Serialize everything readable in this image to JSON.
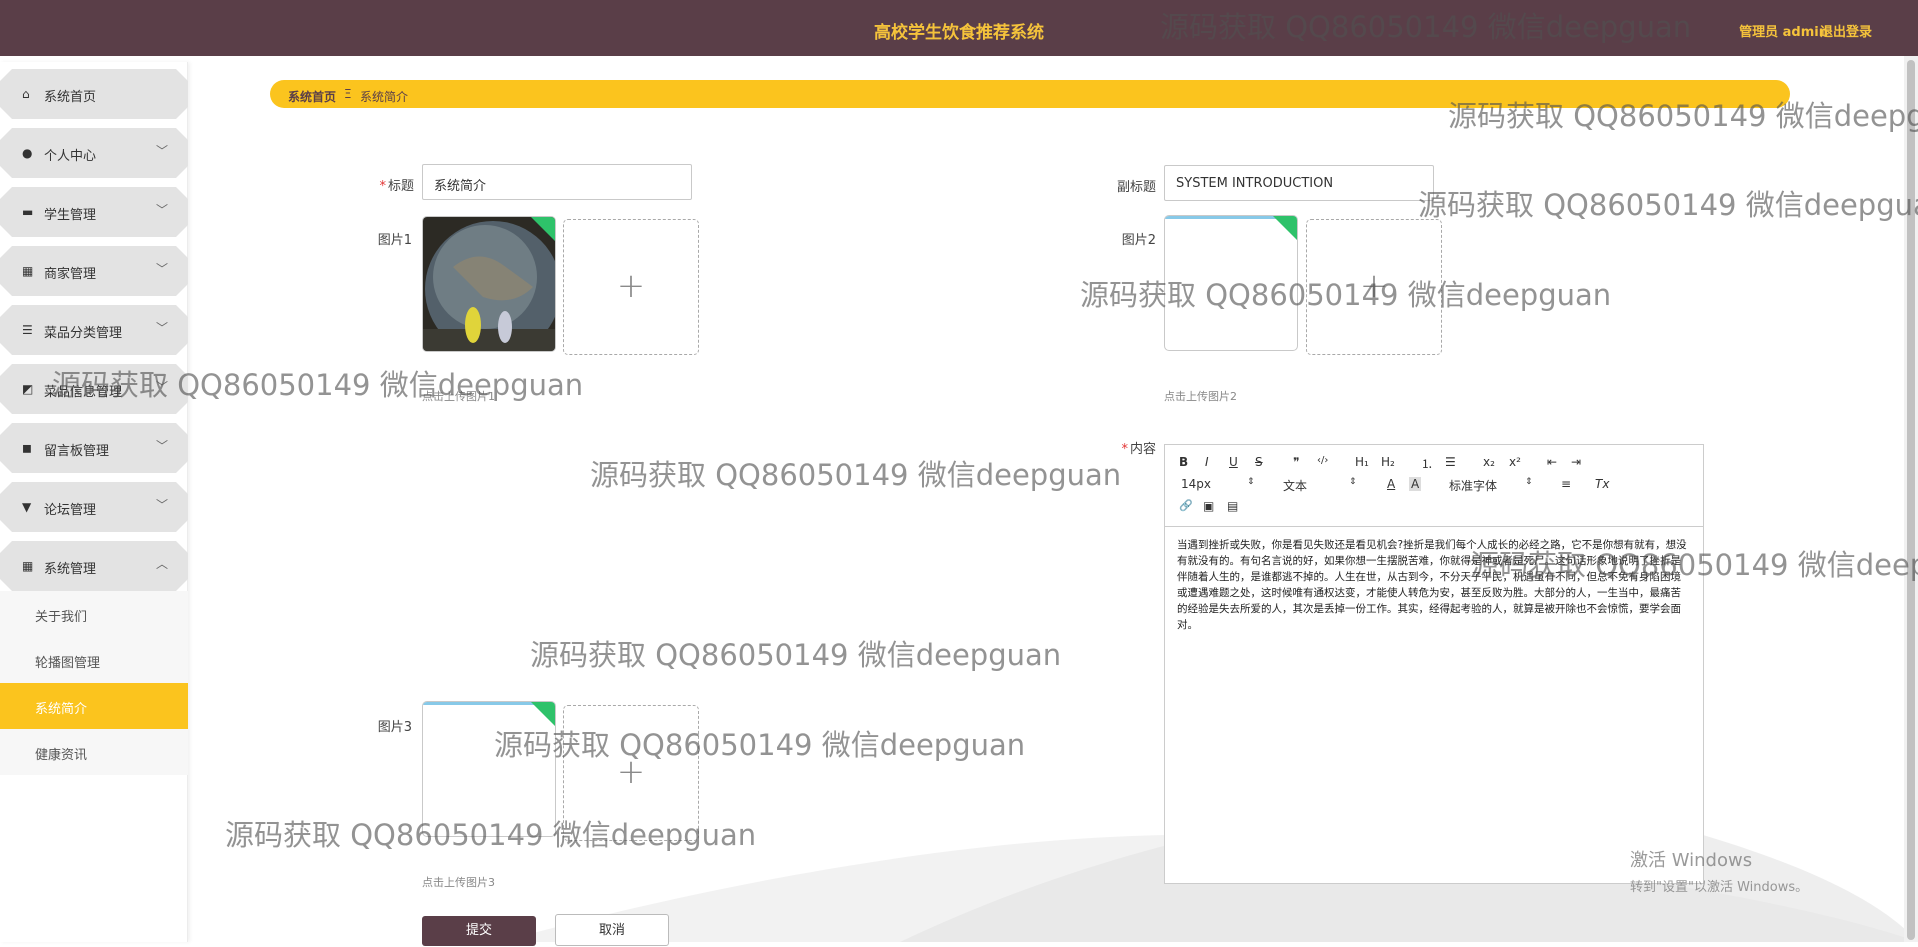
{
  "header": {
    "title": "高校学生饮食推荐系统",
    "user": "管理员 admin",
    "logout": "退出登录"
  },
  "sidebar": {
    "items": [
      {
        "label": "系统首页",
        "icon": "home-icon",
        "glyph": "⌂",
        "chevron": ""
      },
      {
        "label": "个人中心",
        "icon": "user-icon",
        "glyph": "●",
        "chevron": "﹀"
      },
      {
        "label": "学生管理",
        "icon": "monitor-icon",
        "glyph": "▬",
        "chevron": "﹀"
      },
      {
        "label": "商家管理",
        "icon": "grid-icon",
        "glyph": "▦",
        "chevron": "﹀"
      },
      {
        "label": "菜品分类管理",
        "icon": "list-icon",
        "glyph": "☰",
        "chevron": "﹀"
      },
      {
        "label": "菜品信息管理",
        "icon": "chart-icon",
        "glyph": "◩",
        "chevron": "﹀"
      },
      {
        "label": "留言板管理",
        "icon": "video-icon",
        "glyph": "◼",
        "chevron": "﹀"
      },
      {
        "label": "论坛管理",
        "icon": "podium-icon",
        "glyph": "▼",
        "chevron": "﹀"
      },
      {
        "label": "系统管理",
        "icon": "grid-icon",
        "glyph": "▦",
        "chevron": "︿"
      }
    ],
    "subitems": [
      {
        "label": "关于我们",
        "active": false
      },
      {
        "label": "轮播图管理",
        "active": false
      },
      {
        "label": "系统简介",
        "active": true
      },
      {
        "label": "健康资讯",
        "active": false
      }
    ]
  },
  "breadcrumb": {
    "home": "系统首页",
    "separator": "Ξ",
    "current": "系统简介"
  },
  "form": {
    "title_label": "标题",
    "title_value": "系统简介",
    "subtitle_label": "副标题",
    "subtitle_value": "SYSTEM INTRODUCTION",
    "image1_label": "图片1",
    "image1_hint": "点击上传图片1",
    "image2_label": "图片2",
    "image2_hint": "点击上传图片2",
    "image3_label": "图片3",
    "image3_hint": "点击上传图片3",
    "content_label": "内容",
    "upload_plus": "+"
  },
  "editor": {
    "toolbar": {
      "bold": "B",
      "italic": "I",
      "underline": "U",
      "strike": "S",
      "quote": "❞",
      "code": "‹/›",
      "h1": "H₁",
      "h2": "H₂",
      "ol": "⒈",
      "ul": "☰",
      "sub": "x₂",
      "sup": "x²",
      "outdent": "⇤",
      "indent": "⇥",
      "size": "14px",
      "type": "文本",
      "font": "标准字体",
      "color": "A",
      "bg": "A",
      "align": "≡",
      "clear": "Tx",
      "link": "🔗",
      "image": "▣",
      "video": "▤"
    },
    "content": "当遇到挫折或失败，你是看见失败还是看见机会?挫折是我们每个人成长的必经之路，它不是你想有就有，想没有就没有的。有句名言说的好，如果你想一生摆脱苦难，你就得是神或者是死尸。这句话形象地说明了挫折是伴随着人生的，是谁都逃不掉的。人生在世，从古到今，不分天子平民，机遇虽有不同，但总不免有身陷困境或遭遇难题之处，这时候唯有通权达变，才能使人转危为安，甚至反败为胜。大部分的人，一生当中，最痛苦的经验是失去所爱的人，其次是丢掉一份工作。其实，经得起考验的人，就算是被开除也不会惊慌，要学会面对。"
  },
  "buttons": {
    "submit": "提交",
    "cancel": "取消"
  },
  "watermark": "源码获取 QQ86050149 微信deepguan",
  "activation": {
    "line1": "激活 Windows",
    "line2": "转到\"设置\"以激活 Windows。"
  },
  "colors": {
    "header_bg": "#5a3e48",
    "accent": "#fbc41e",
    "title_color": "#f5c33b",
    "primary_button": "#5a3e48"
  }
}
